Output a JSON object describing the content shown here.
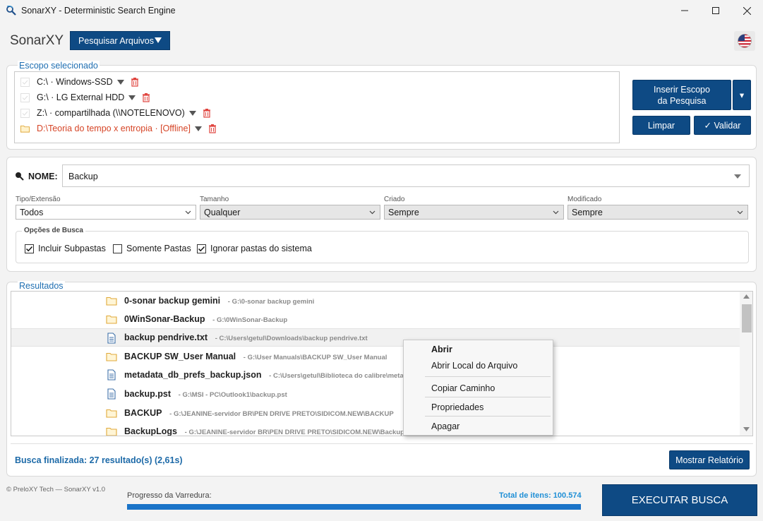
{
  "window": {
    "title": "SonarXY - Deterministic Search Engine",
    "minimize_icon": "minimize-icon",
    "maximize_icon": "maximize-icon",
    "close_icon": "close-icon"
  },
  "header": {
    "brand": "SonarXY",
    "mode_button": "Pesquisar Arquivos",
    "language_flag": "us-flag-icon"
  },
  "scope": {
    "legend": "Escopo selecionado",
    "items": [
      {
        "label": "C:\\ · Windows-SSD",
        "offline": false
      },
      {
        "label": "G:\\ · LG External HDD",
        "offline": false
      },
      {
        "label": "Z:\\ · compartilhada (\\\\NOTELENOVO)",
        "offline": false
      },
      {
        "label": "D:\\Teoria do tempo x entropia · [Offline]",
        "offline": true
      }
    ],
    "insert_button": "Inserir Escopo da Pesquisa",
    "insert_line1": "Inserir Escopo",
    "insert_line2": "da Pesquisa",
    "insert_more": "▾",
    "clear_button": "Limpar",
    "validate_button": "✓ Validar"
  },
  "search": {
    "name_label": "NOME:",
    "name_value": "Backup",
    "filters": [
      {
        "label": "Tipo/Extensão",
        "value": "Todos"
      },
      {
        "label": "Tamanho",
        "value": "Qualquer"
      },
      {
        "label": "Criado",
        "value": "Sempre"
      },
      {
        "label": "Modificado",
        "value": "Sempre"
      }
    ],
    "options_legend": "Opções de Busca",
    "options": [
      {
        "label": "Incluir Subpastas",
        "checked": true
      },
      {
        "label": "Somente Pastas",
        "checked": false
      },
      {
        "label": "Ignorar pastas do sistema",
        "checked": true
      }
    ]
  },
  "results": {
    "legend": "Resultados",
    "rows": [
      {
        "name": "0-sonar backup gemini",
        "path": "G:\\0-sonar backup gemini",
        "type": "folder"
      },
      {
        "name": "0WinSonar-Backup",
        "path": "G:\\0WinSonar-Backup",
        "type": "folder"
      },
      {
        "name": "backup pendrive.txt",
        "path": "C:\\Users\\getul\\Downloads\\backup pendrive.txt",
        "type": "file"
      },
      {
        "name": "BACKUP SW_User Manual",
        "path": "G:\\User Manuals\\BACKUP SW_User Manual",
        "type": "folder"
      },
      {
        "name": "metadata_db_prefs_backup.json",
        "path": "C:\\Users\\getul\\Biblioteca do calibre\\metadata_",
        "type": "file"
      },
      {
        "name": "backup.pst",
        "path": "G:\\MSI - PC\\Outlook1\\backup.pst",
        "type": "file"
      },
      {
        "name": "BACKUP",
        "path": "G:\\JEANINE-servidor BR\\PEN DRIVE PRETO\\SIDICOM.NEW\\BACKUP",
        "type": "folder"
      },
      {
        "name": "BackupLogs",
        "path": "G:\\JEANINE-servidor BR\\PEN DRIVE PRETO\\SIDICOM.NEW\\BackupLogs",
        "type": "folder"
      }
    ],
    "status": "Busca finalizada: 27 resultado(s) (2,61s)",
    "report_button": "Mostrar Relatório"
  },
  "context_menu": {
    "items": [
      "Abrir",
      "Abrir Local do Arquivo",
      "Copiar Caminho",
      "Propriedades",
      "Apagar"
    ]
  },
  "footer": {
    "copyright": "© PreloXY Tech — SonarXY v1.0",
    "progress_label": "Progresso da Varredura:",
    "progress_total": "Total de itens: 100.574",
    "progress_fraction": 1.0,
    "run_button": "EXECUTAR BUSCA"
  },
  "colors": {
    "accent": "#0e4a84",
    "legend_blue": "#1f6fb2",
    "offline_red": "#d64527",
    "progress_blue": "#1a73c8"
  }
}
